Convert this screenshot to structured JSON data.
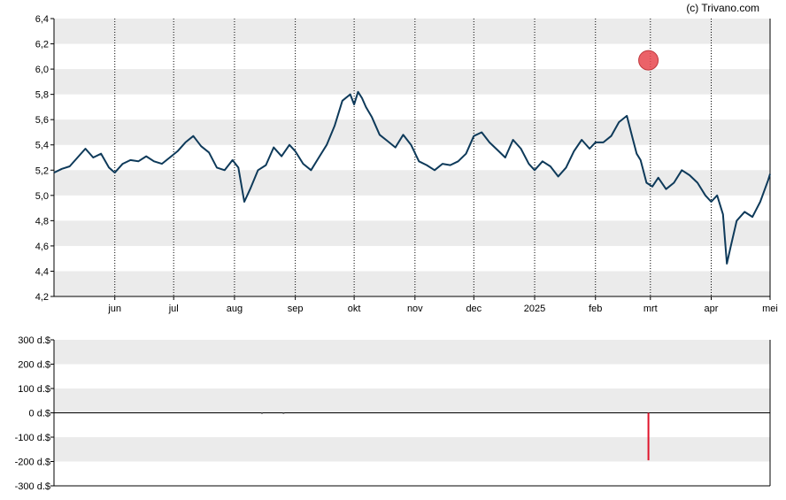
{
  "copyright": "(c) Trivano.com",
  "colors": {
    "price_line": "#0e3a5a",
    "band": "#ebebeb",
    "axis": "#000000",
    "marker_fill": "#e8474d",
    "insider_bar": "#e0142b"
  },
  "chart_data": [
    {
      "type": "line",
      "title": "",
      "xlabel": "",
      "ylabel": "",
      "ylim": [
        4.2,
        6.4
      ],
      "y_ticks": [
        "4,2",
        "4,4",
        "4,6",
        "4,8",
        "5,0",
        "5,2",
        "5,4",
        "5,6",
        "5,8",
        "6,0",
        "6,2",
        "6,4"
      ],
      "x_ticks": [
        "jun",
        "jul",
        "aug",
        "sep",
        "okt",
        "nov",
        "dec",
        "2025",
        "feb",
        "mrt",
        "apr",
        "mei"
      ],
      "x_tick_dates": [
        "2024-06-01",
        "2024-07-01",
        "2024-08-01",
        "2024-09-01",
        "2024-10-01",
        "2024-11-01",
        "2024-12-01",
        "2025-01-01",
        "2025-02-01",
        "2025-03-01",
        "2025-04-01",
        "2025-05-01"
      ],
      "x_range": [
        "2024-05-01",
        "2025-05-01"
      ],
      "grid": "alternating horizontal bands, dotted vertical lines at month starts",
      "series": [
        {
          "x": [
            "2024-05-01",
            "2024-05-05",
            "2024-05-09",
            "2024-05-13",
            "2024-05-17",
            "2024-05-21",
            "2024-05-25",
            "2024-05-29",
            "2024-06-01",
            "2024-06-05",
            "2024-06-09",
            "2024-06-13",
            "2024-06-17",
            "2024-06-21",
            "2024-06-25",
            "2024-06-29",
            "2024-07-03",
            "2024-07-07",
            "2024-07-11",
            "2024-07-15",
            "2024-07-19",
            "2024-07-23",
            "2024-07-27",
            "2024-07-31",
            "2024-08-03",
            "2024-08-06",
            "2024-08-09",
            "2024-08-13",
            "2024-08-17",
            "2024-08-21",
            "2024-08-25",
            "2024-08-29",
            "2024-09-01",
            "2024-09-05",
            "2024-09-09",
            "2024-09-13",
            "2024-09-17",
            "2024-09-21",
            "2024-09-25",
            "2024-09-29",
            "2024-10-01",
            "2024-10-03",
            "2024-10-05",
            "2024-10-07",
            "2024-10-10",
            "2024-10-14",
            "2024-10-18",
            "2024-10-22",
            "2024-10-26",
            "2024-10-30",
            "2024-11-03",
            "2024-11-07",
            "2024-11-11",
            "2024-11-15",
            "2024-11-19",
            "2024-11-23",
            "2024-11-27",
            "2024-12-01",
            "2024-12-05",
            "2024-12-09",
            "2024-12-13",
            "2024-12-17",
            "2024-12-21",
            "2024-12-25",
            "2024-12-29",
            "2025-01-01",
            "2025-01-05",
            "2025-01-09",
            "2025-01-13",
            "2025-01-17",
            "2025-01-21",
            "2025-01-25",
            "2025-01-29",
            "2025-02-01",
            "2025-02-05",
            "2025-02-09",
            "2025-02-13",
            "2025-02-17",
            "2025-02-20",
            "2025-02-22",
            "2025-02-24",
            "2025-02-27",
            "2025-03-02",
            "2025-03-05",
            "2025-03-09",
            "2025-03-13",
            "2025-03-17",
            "2025-03-21",
            "2025-03-25",
            "2025-03-29",
            "2025-04-01",
            "2025-04-04",
            "2025-04-07",
            "2025-04-09",
            "2025-04-11",
            "2025-04-14",
            "2025-04-18",
            "2025-04-22",
            "2025-04-26",
            "2025-04-30",
            "2025-05-01"
          ],
          "values": [
            5.18,
            5.21,
            5.23,
            5.3,
            5.37,
            5.3,
            5.33,
            5.22,
            5.18,
            5.25,
            5.28,
            5.27,
            5.31,
            5.27,
            5.25,
            5.3,
            5.35,
            5.42,
            5.47,
            5.39,
            5.34,
            5.22,
            5.2,
            5.28,
            5.22,
            4.95,
            5.05,
            5.2,
            5.24,
            5.38,
            5.31,
            5.4,
            5.35,
            5.25,
            5.2,
            5.3,
            5.4,
            5.55,
            5.75,
            5.8,
            5.72,
            5.82,
            5.77,
            5.7,
            5.62,
            5.48,
            5.43,
            5.38,
            5.48,
            5.4,
            5.27,
            5.24,
            5.2,
            5.25,
            5.24,
            5.27,
            5.33,
            5.47,
            5.5,
            5.42,
            5.36,
            5.3,
            5.44,
            5.37,
            5.25,
            5.2,
            5.27,
            5.23,
            5.15,
            5.22,
            5.35,
            5.44,
            5.37,
            5.42,
            5.42,
            5.47,
            5.58,
            5.63,
            5.45,
            5.33,
            5.28,
            5.1,
            5.07,
            5.14,
            5.05,
            5.1,
            5.2,
            5.16,
            5.1,
            5.0,
            4.95,
            5.0,
            4.85,
            4.46,
            4.6,
            4.8,
            4.87,
            4.83,
            4.95,
            5.12,
            5.17
          ]
        }
      ],
      "annotations": [
        {
          "type": "marker",
          "x": "2025-02-28",
          "y": 6.07
        }
      ]
    },
    {
      "type": "bar",
      "title": "",
      "xlabel": "",
      "ylabel": "",
      "ylim": [
        -300,
        300
      ],
      "y_ticks": [
        "300 d.$",
        "200 d.$",
        "100 d.$",
        "0 d.$",
        "-100 d.$",
        "-200 d.$",
        "-300 d.$"
      ],
      "x_range": [
        "2024-05-01",
        "2025-05-01"
      ],
      "grid": "alternating horizontal bands",
      "bars": [
        {
          "x": "2024-08-15",
          "value": 2
        },
        {
          "x": "2024-08-26",
          "value": 1
        },
        {
          "x": "2025-02-28",
          "value": -195
        }
      ]
    }
  ]
}
